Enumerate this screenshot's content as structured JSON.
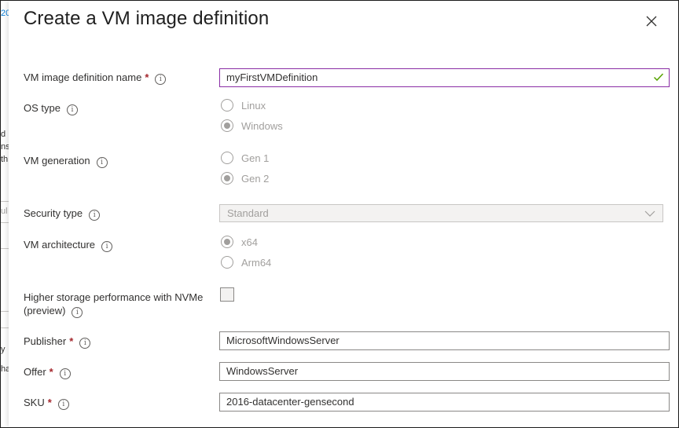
{
  "panel": {
    "title": "Create a VM image definition",
    "close_label": "Close"
  },
  "background_fragments": [
    "20",
    "d",
    "ns",
    "th",
    "ul",
    "y",
    "ha"
  ],
  "fields": {
    "image_definition_name": {
      "label": "VM image definition name",
      "required": "*",
      "value": "myFirstVMDefinition",
      "valid": true
    },
    "os_type": {
      "label": "OS type",
      "options": [
        "Linux",
        "Windows"
      ],
      "selected": "Windows"
    },
    "vm_generation": {
      "label": "VM generation",
      "options": [
        "Gen 1",
        "Gen 2"
      ],
      "selected": "Gen 2"
    },
    "security_type": {
      "label": "Security type",
      "value": "Standard",
      "disabled": true
    },
    "vm_architecture": {
      "label": "VM architecture",
      "options": [
        "x64",
        "Arm64"
      ],
      "selected": "x64"
    },
    "nvme": {
      "label_line1": "Higher storage performance with NVMe",
      "label_line2": "(preview)",
      "checked": false
    },
    "publisher": {
      "label": "Publisher",
      "required": "*",
      "value": "MicrosoftWindowsServer"
    },
    "offer": {
      "label": "Offer",
      "required": "*",
      "value": "WindowsServer"
    },
    "sku": {
      "label": "SKU",
      "required": "*",
      "value": "2016-datacenter-gensecond"
    }
  },
  "icons": {
    "info": "info-icon",
    "close": "close-icon",
    "valid": "checkmark-icon",
    "dropdown": "chevron-down-icon"
  },
  "colors": {
    "focus_border": "#8a2da5",
    "valid_check": "#57a300",
    "required": "#a4262c",
    "disabled_text": "#a19f9d"
  }
}
